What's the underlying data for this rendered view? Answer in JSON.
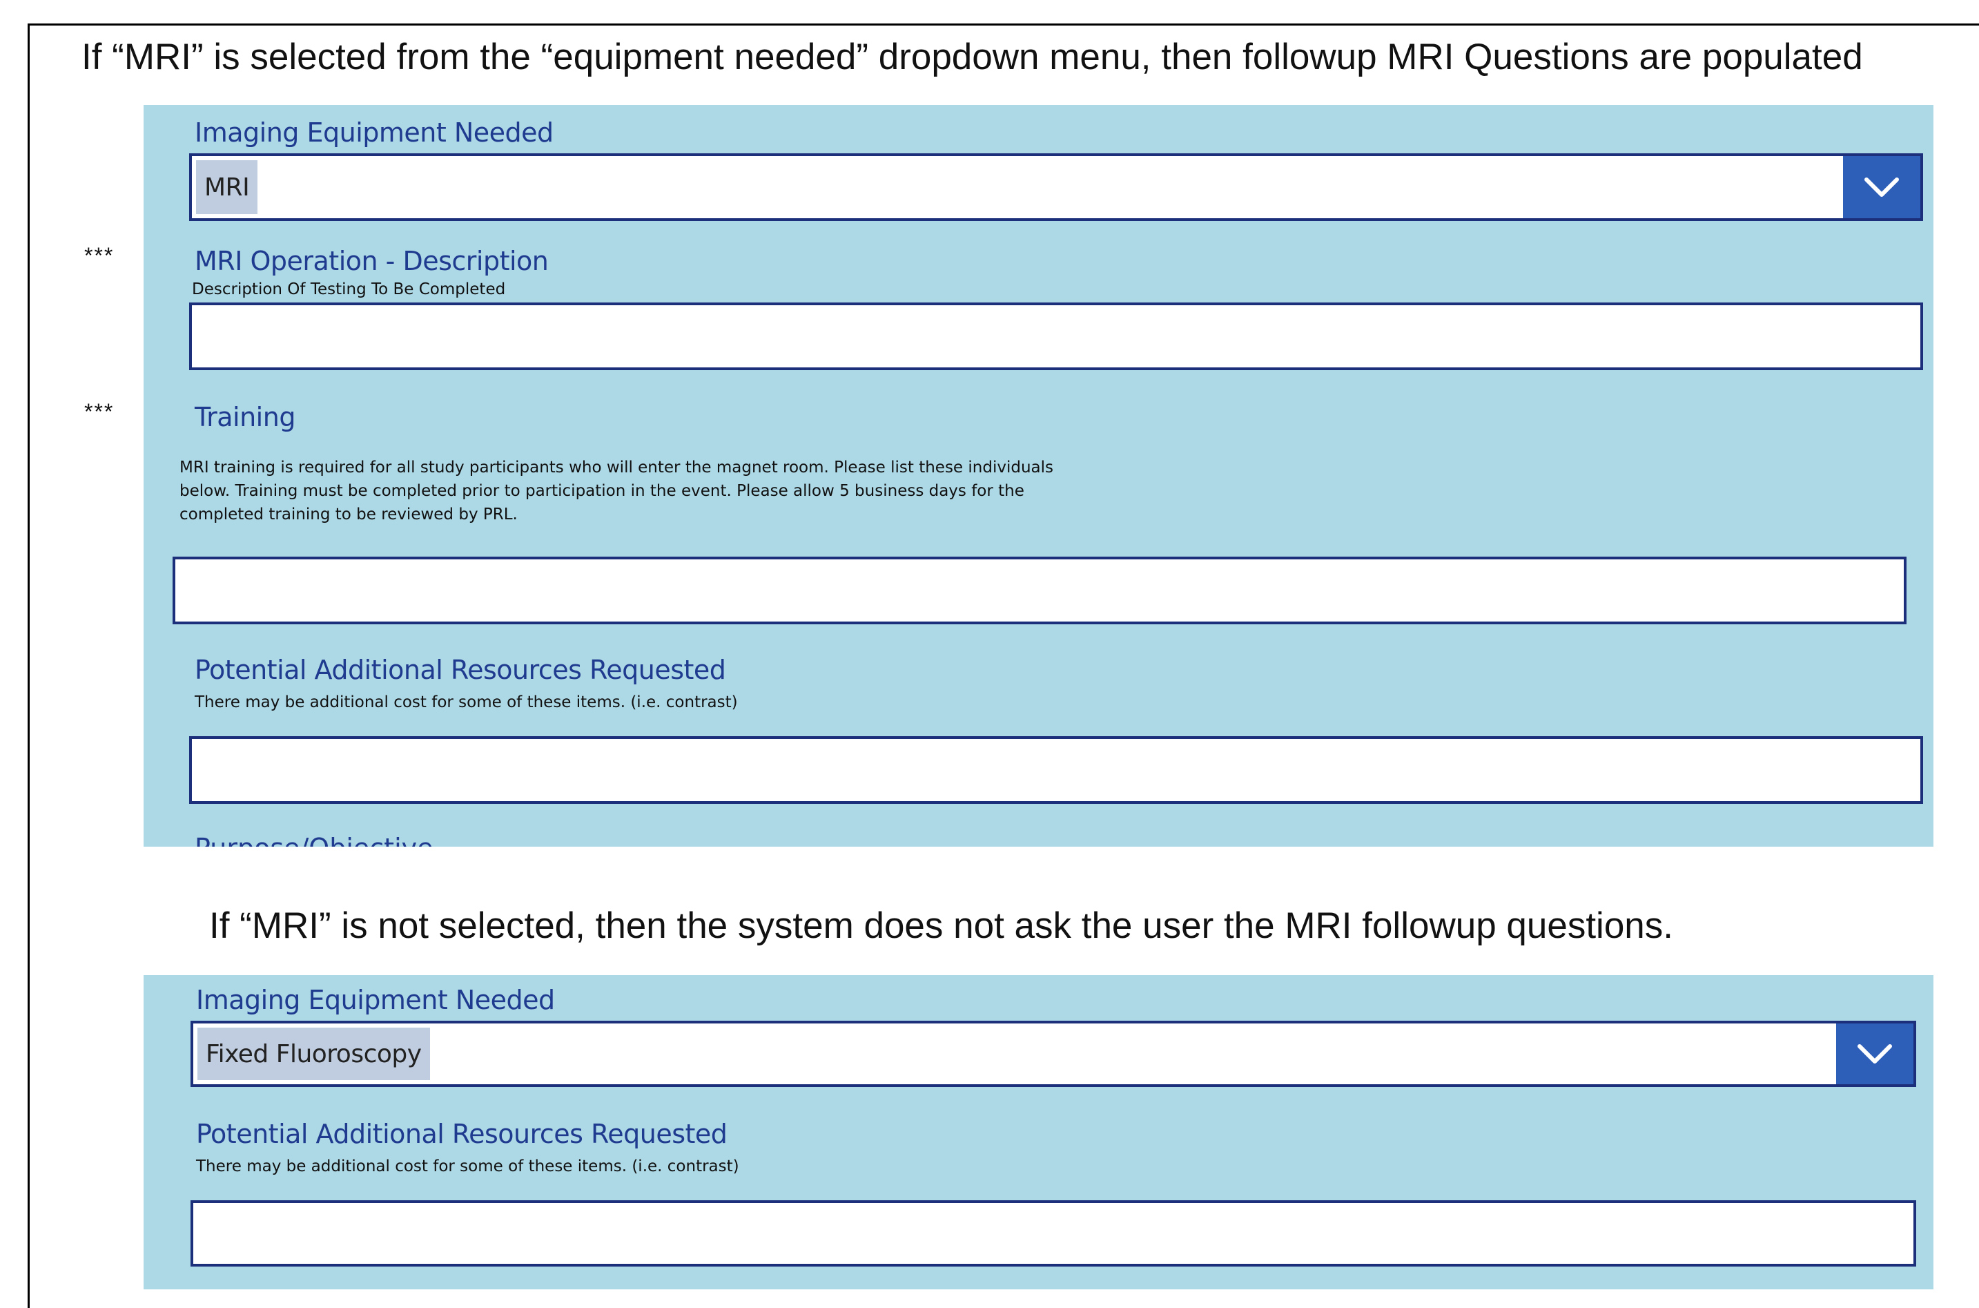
{
  "captions": {
    "top": "If “MRI” is selected from the “equipment needed” dropdown menu, then followup MRI Questions are populated",
    "bottom": "If “MRI” is not selected, then the system does not ask the user the MRI followup questions."
  },
  "markers": {
    "description": "***",
    "training": "***"
  },
  "form_mri": {
    "equipment_label": "Imaging Equipment Needed",
    "equipment_value": "MRI",
    "description_label": "MRI Operation - Description",
    "description_sublabel": "Description Of Testing To Be Completed",
    "description_value": "",
    "training_label": "Training",
    "training_text": "MRI training is required for all study participants who will enter the magnet room. Please list these individuals below.  Training must be completed prior to participation in the event. Please allow 5 business days for the completed training to be reviewed by PRL.",
    "training_value": "",
    "resources_label": "Potential Additional Resources Requested",
    "resources_sublabel": "There may be additional cost for some of these items. (i.e. contrast)",
    "resources_value": "",
    "cut_off_label": "Purpose/Objective"
  },
  "form_other": {
    "equipment_label": "Imaging Equipment Needed",
    "equipment_value": "Fixed Fluoroscopy",
    "resources_label": "Potential Additional Resources Requested",
    "resources_sublabel": "There may be additional cost for some of these items. (i.e. contrast)",
    "resources_value": ""
  },
  "icons": {
    "dropdown": "chevron-down-icon"
  },
  "colors": {
    "panel": "#add8e6",
    "label": "#1f3b8f",
    "field_border": "#1b2f7a",
    "dropdown_button": "#2e5fb8"
  }
}
